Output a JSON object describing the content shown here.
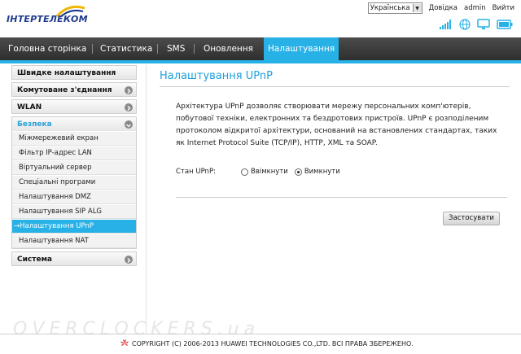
{
  "brand": {
    "logo_text": "ІНТЕРТЕЛЕКОМ"
  },
  "top_links": {
    "language": "Українська",
    "help": "Довідка",
    "user": "admin",
    "logout": "Вийти"
  },
  "nav": {
    "items": [
      "Головна сторінка",
      "Статистика",
      "SMS",
      "Оновлення",
      "Налаштування"
    ],
    "active": "Налаштування"
  },
  "sidebar": {
    "items": [
      {
        "label": "Швидке налаштування"
      },
      {
        "label": "Комутоване з'єднання"
      },
      {
        "label": "WLAN"
      },
      {
        "label": "Безпека"
      },
      {
        "label": "Система"
      }
    ],
    "security_sub": [
      "Міжмережевий екран",
      "Фільтр IP-адрес LAN",
      "Віртуальний сервер",
      "Спеціальні програми",
      "Налаштування DMZ",
      "Налаштування SIP ALG",
      "→Налаштування UPnP",
      "Налаштування NAT"
    ]
  },
  "main": {
    "title": "Налаштування UPnP",
    "description": "Архітектура UPnP дозволяє створювати мережу персональних комп'ютерів, побутової техніки, електронних та бездротових пристроїв. UPnP є розподіленим протоколом відкритої архітектури, оснований на встановлених стандартах, таких як Internet Protocol Suite (TCP/IP), HTTP, XML та SOAP.",
    "status_label": "Стан UPnP:",
    "option_on": "Ввімкнути",
    "option_off": "Вимкнути",
    "selected": "off",
    "apply_button": "Застосувати"
  },
  "footer": {
    "copyright": "COPYRIGHT (C) 2006-2013 HUAWEI TECHNOLOGIES CO.,LTD. ВСІ ПРАВА ЗБЕРЕЖЕНО."
  },
  "watermark": "OVERCLOCKERS.ua",
  "colors": {
    "accent": "#27b1e6",
    "nav_bg": "#3a3a3a",
    "title": "#1aa0dc"
  }
}
